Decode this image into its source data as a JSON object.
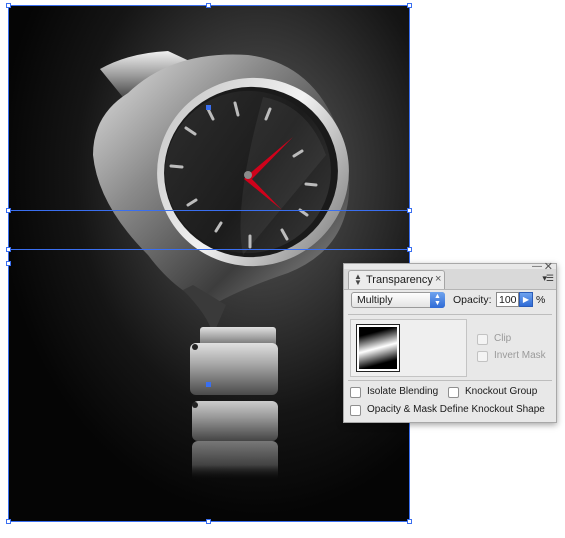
{
  "panel": {
    "tab_label": "Transparency",
    "tab_close_glyph": "×",
    "minimize_glyph": "—",
    "close_glyph": "✕",
    "menu_glyph": "▾☰",
    "blend_mode": "Multiply",
    "opacity_label": "Opacity:",
    "opacity_value": "100",
    "opacity_unit": "%",
    "clip_label": "Clip",
    "invert_mask_label": "Invert Mask",
    "isolate_blending_label": "Isolate Blending",
    "knockout_group_label": "Knockout Group",
    "opacity_mask_knockout_label": "Opacity & Mask Define Knockout Shape",
    "checkboxes": {
      "clip": false,
      "invert_mask": false,
      "isolate_blending": false,
      "knockout_group": false,
      "opacity_mask_knockout": false
    },
    "accent_color": "#3a78e0"
  },
  "artwork": {
    "subject": "watch-illustration",
    "hand_color": "#d0021b",
    "selection_color": "#3a6ff0"
  }
}
